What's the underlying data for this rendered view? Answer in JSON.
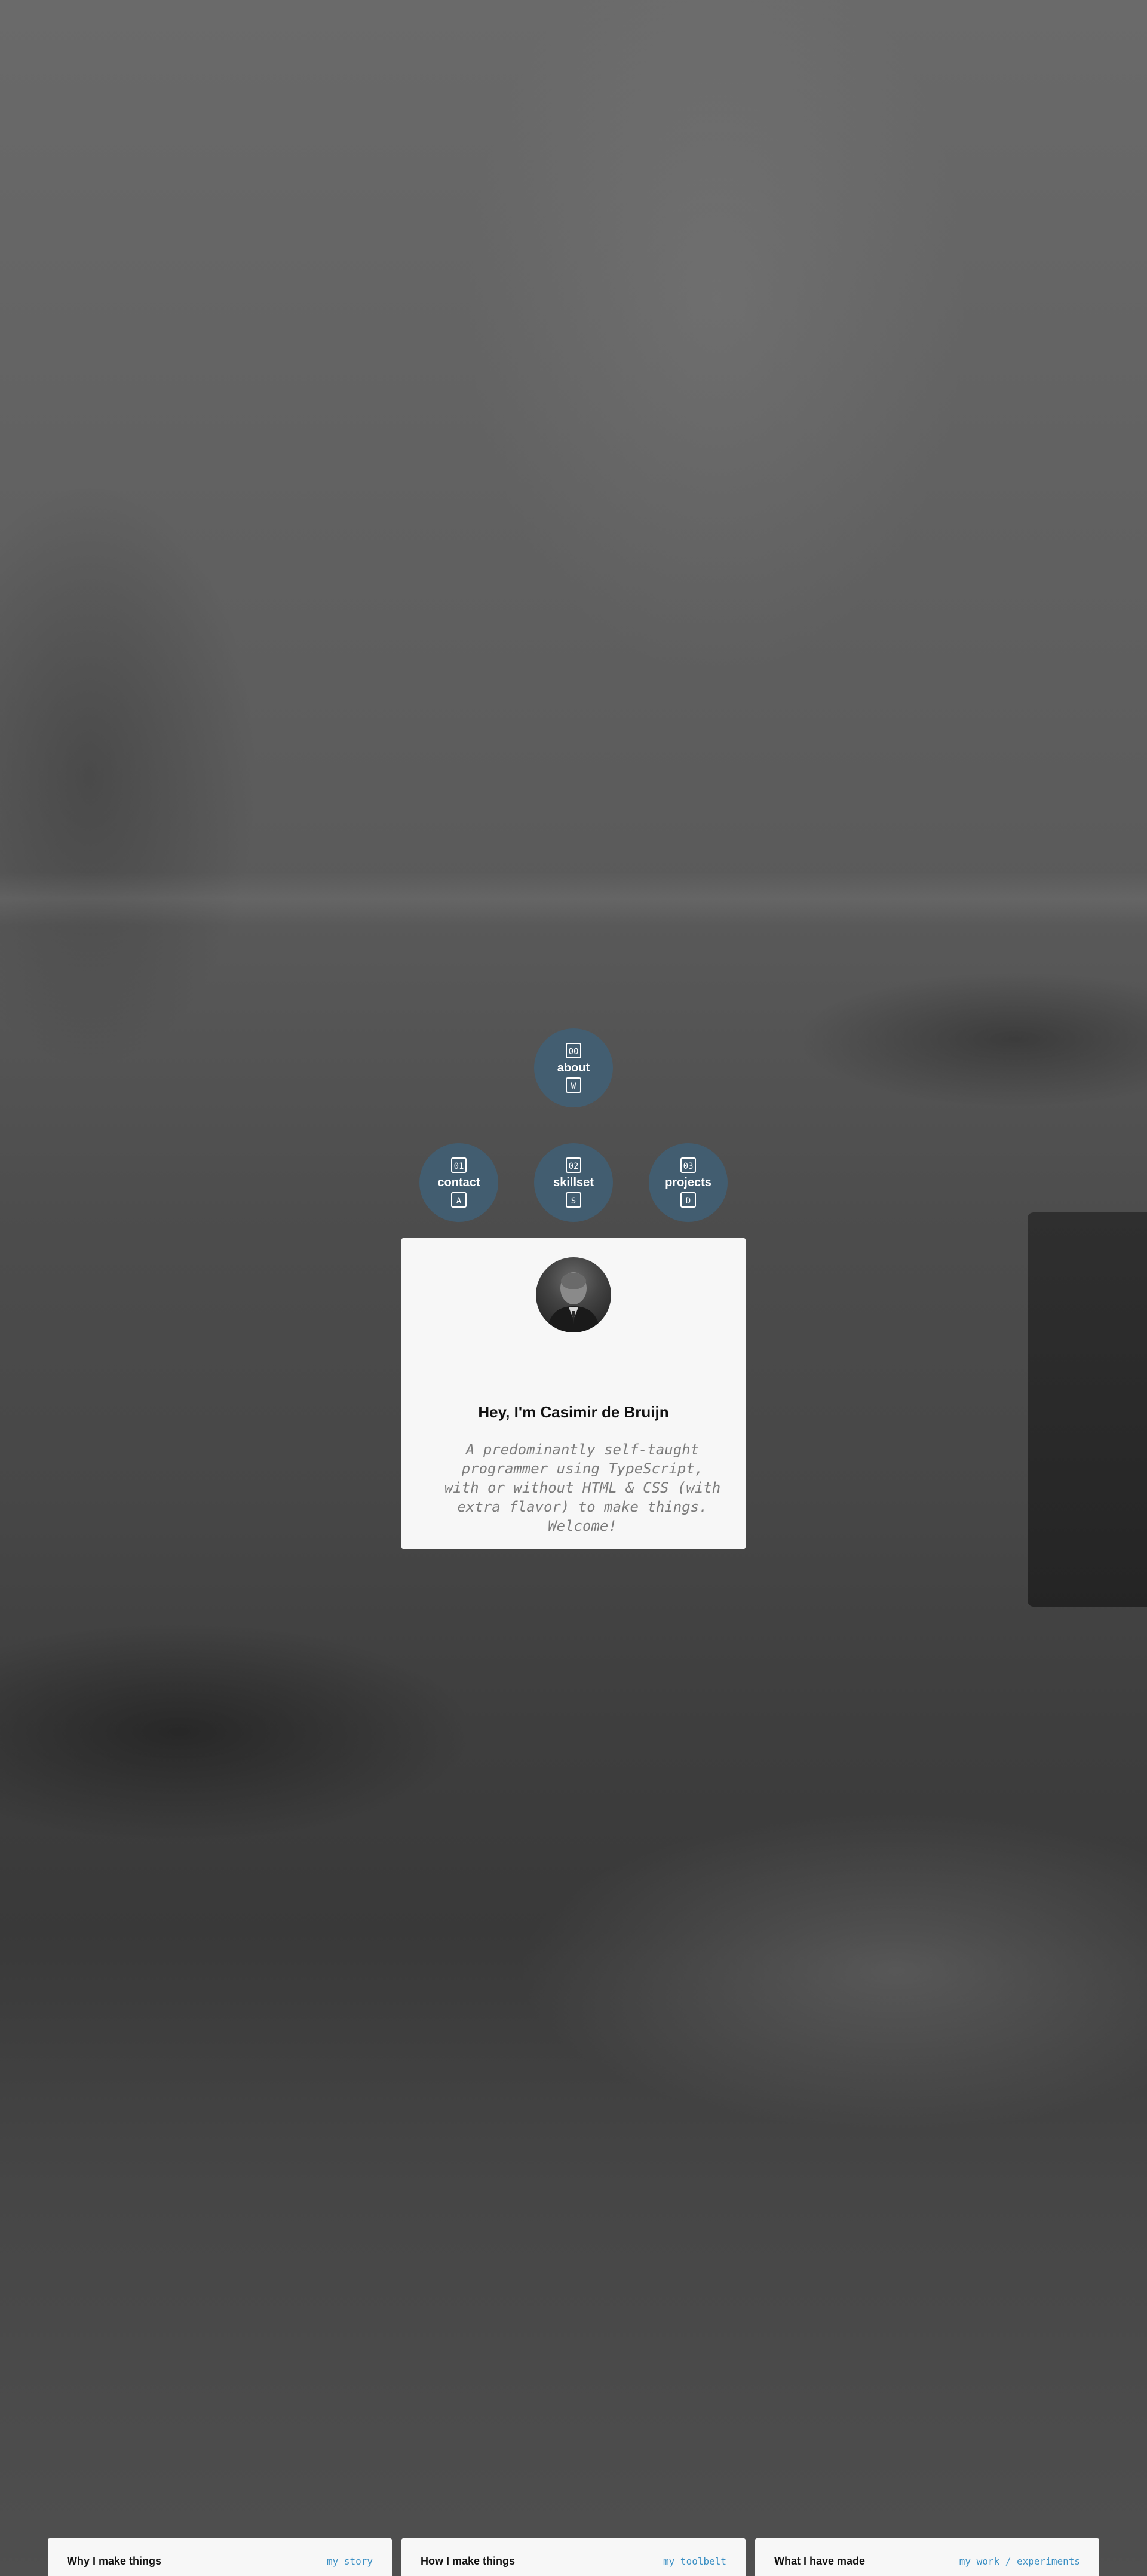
{
  "nav": {
    "about": {
      "num": "00",
      "label": "about",
      "key": "W"
    },
    "contact": {
      "num": "01",
      "label": "contact",
      "key": "A"
    },
    "skillset": {
      "num": "02",
      "label": "skillset",
      "key": "S"
    },
    "projects": {
      "num": "03",
      "label": "projects",
      "key": "D"
    }
  },
  "intro": {
    "heading": "Hey, I'm Casimir de Bruijn",
    "description": "A predominantly self-taught programmer using TypeScript, with or without HTML & CSS (with extra flavor) to make things. Welcome!"
  },
  "cards": [
    {
      "title": "Why I make things",
      "link": "my story"
    },
    {
      "title": "How I make things",
      "link": "my toolbelt"
    },
    {
      "title": "What I have made",
      "link": "my work / experiments"
    }
  ],
  "colors": {
    "nav_circle": "#3f627a",
    "card_bg": "#f7f7f7",
    "link": "#3a8fc4"
  }
}
